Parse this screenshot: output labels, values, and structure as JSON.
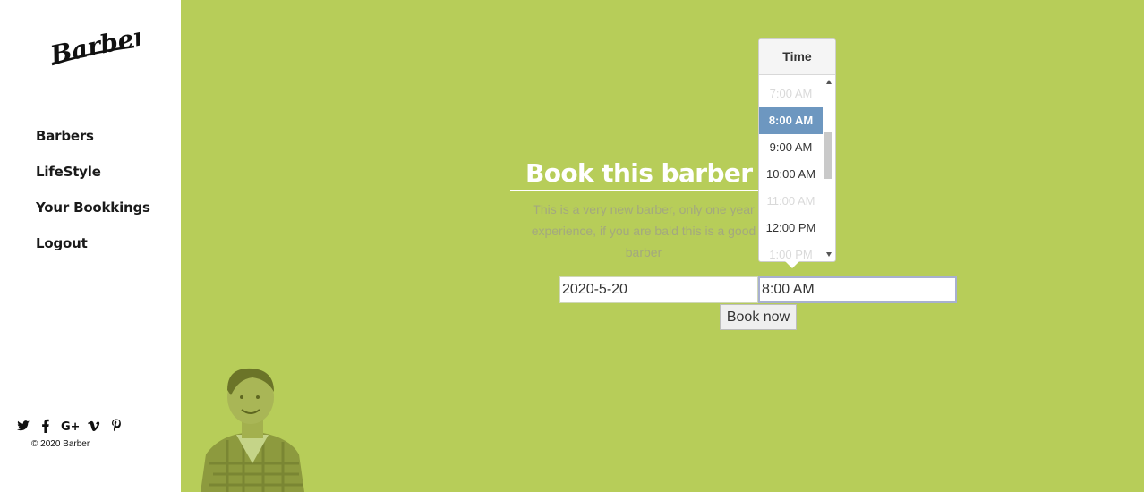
{
  "brand": {
    "logo_text": "Barber"
  },
  "nav": [
    {
      "label": "Barbers"
    },
    {
      "label": "LifeStyle"
    },
    {
      "label": "Your Bookkings"
    },
    {
      "label": "Logout"
    }
  ],
  "social": [
    "twitter-icon",
    "facebook-icon",
    "google-plus-icon",
    "vimeo-icon",
    "pinterest-icon"
  ],
  "footer": {
    "copyright": "© 2020 Barber"
  },
  "colors": {
    "main_bg": "#b7cd59",
    "accent_selected": "#6d97c0"
  },
  "booking": {
    "title": "Book this barber now",
    "description": "This is a very new barber, only one year experience, if you are bald this is a good barber",
    "date_value": "2020-5-20",
    "time_value": "8:00 AM",
    "button_label": "Book now"
  },
  "time_picker": {
    "header": "Time",
    "options": [
      {
        "label": "7:00 AM",
        "state": "disabled"
      },
      {
        "label": "8:00 AM",
        "state": "selected"
      },
      {
        "label": "9:00 AM",
        "state": "available"
      },
      {
        "label": "10:00 AM",
        "state": "available"
      },
      {
        "label": "11:00 AM",
        "state": "disabled"
      },
      {
        "label": "12:00 PM",
        "state": "available"
      },
      {
        "label": "1:00 PM",
        "state": "disabled"
      }
    ]
  }
}
